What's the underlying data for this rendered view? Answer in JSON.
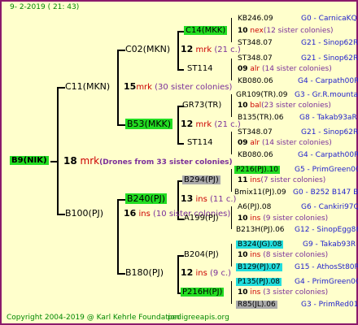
{
  "header": "9-  2-2019 (  21:  43)",
  "footer": {
    "copyright": "Copyright 2004-2019 @ Karl Kehrle Foundation",
    "site": "pedigreeapis.org"
  },
  "root": {
    "name": "B9(NIK)",
    "num": "18",
    "code": "mrk",
    "note": "(Drones from 33 sister colonies)"
  },
  "gen1": [
    {
      "name": "C11(MKN)",
      "num": "15",
      "code": "mrk",
      "note": "(30 sister colonies)"
    },
    {
      "name": "B100(PJ)",
      "num": "16",
      "code": "ins",
      "note": "(10 sister colonies)"
    }
  ],
  "gen2": [
    {
      "name": "C02(MKN)",
      "num": "12",
      "code": "mrk",
      "note": "(21 c.)"
    },
    {
      "name": "B53(MKK)",
      "num": "12",
      "code": "mrk",
      "note": "(21 c.)"
    },
    {
      "name": "B240(PJ)",
      "num": "13",
      "code": "ins",
      "note": "(11 c.)"
    },
    {
      "name": "B180(PJ)",
      "num": "12",
      "code": "ins",
      "note": "(9 c.)"
    }
  ],
  "gen3": [
    {
      "name": "C14(MKK)",
      "num": "10",
      "code": "nex",
      "note": "(12 sister colonies)"
    },
    {
      "name": "ST114"
    },
    {
      "name": "GR73(TR)",
      "num": "10",
      "code": "bal",
      "note": "(23 sister colonies)"
    },
    {
      "name": "ST114"
    },
    {
      "name": "B294(PJ)",
      "num": "11",
      "code": "ins",
      "note": "(7 sister colonies)"
    },
    {
      "name": "A199(PJ)",
      "num": "10",
      "code": "ins",
      "note": "(9 sister colonies)"
    },
    {
      "name": "B204(PJ)",
      "num": "10",
      "code": "ins",
      "note": "(8 sister colonies)"
    },
    {
      "name": "P216H(PJ)",
      "num": "10",
      "code": "ins",
      "note": "(3 sister colonies)"
    }
  ],
  "gen4": [
    {
      "name": "KB246.09",
      "ref": "G0 - CarnicaKQ"
    },
    {
      "name": "ST348.07",
      "ref": "G21 - Sinop62R"
    },
    {
      "name": "ST348.07",
      "ref": "G21 - Sinop62R"
    },
    {
      "name": "KB080.06",
      "ref": "G4 - Carpath00R"
    },
    {
      "name": "GR109(TR).09",
      "ref": "G3 - Gr.R.mounta"
    },
    {
      "name": "B135(TR).06",
      "ref": "G8 - Takab93aR"
    },
    {
      "name": "ST348.07",
      "ref": "G21 - Sinop62R"
    },
    {
      "name": "KB080.06",
      "ref": "G4 - Carpath00R"
    },
    {
      "name": "P216(PJ).10",
      "ref": "G5 - PrimGreen00"
    },
    {
      "name": "Bmix11(PJ).09",
      "ref": "G0 - B252 B147 B"
    },
    {
      "name": "A6(PJ).08",
      "ref": "G6 - Cankiri97Q"
    },
    {
      "name": "B213H(PJ).06",
      "ref": "G12 - SinopEgg86R"
    },
    {
      "name": "B324(JG).08",
      "ref": "G9 - Takab93R"
    },
    {
      "name": "B129(PJ).07",
      "ref": "G15 - AthosSt80R"
    },
    {
      "name": "P135(PJ).08",
      "ref": "G4 - PrimGreen00"
    },
    {
      "name": "R85(JL).06",
      "ref": "G3 - PrimRed01"
    }
  ],
  "gen3_codes": [
    {
      "num": "10",
      "code": "nex",
      "note": "(12 sister colonies)"
    },
    {
      "num": "09",
      "code": "alr",
      "note": "(14 sister colonies)"
    },
    {
      "num": "10",
      "code": "bal",
      "note": "(23 sister colonies)"
    },
    {
      "num": "09",
      "code": "alr",
      "note": "(14 sister colonies)"
    },
    {
      "num": "11",
      "code": "ins",
      "note": "(7 sister colonies)"
    },
    {
      "num": "10",
      "code": "ins",
      "note": "(9 sister colonies)"
    },
    {
      "num": "10",
      "code": "ins",
      "note": "(8 sister colonies)"
    },
    {
      "num": "10",
      "code": "ins",
      "note": "(3 sister colonies)"
    }
  ]
}
